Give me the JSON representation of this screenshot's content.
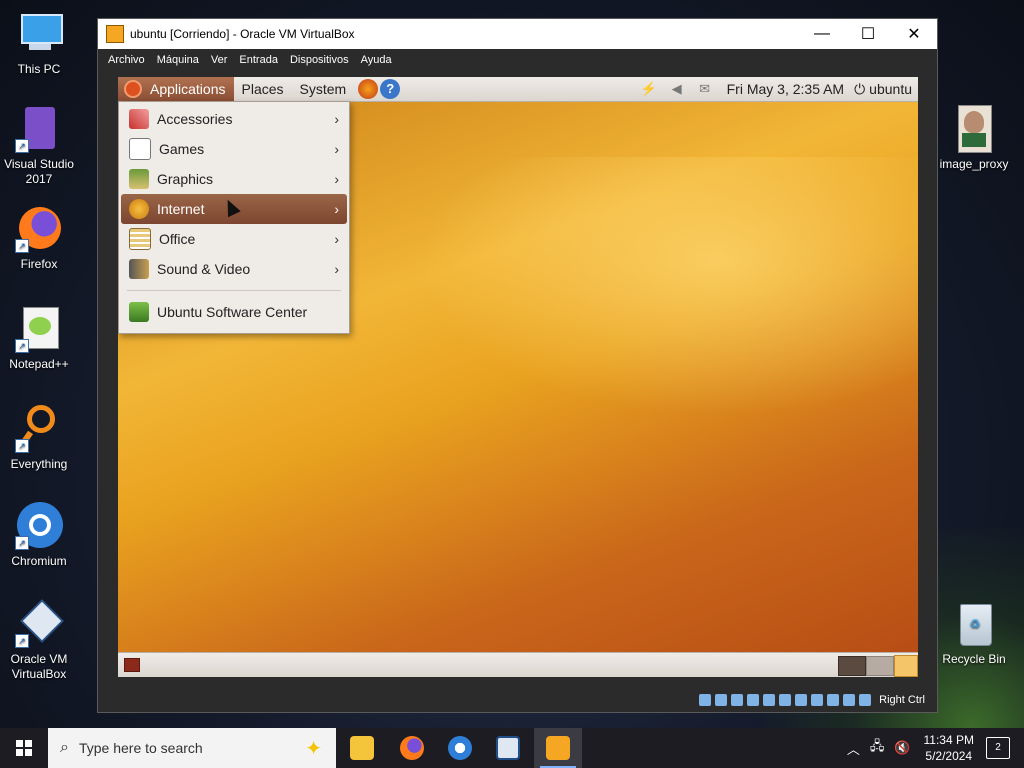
{
  "desktop": {
    "icons": [
      {
        "label": "This PC"
      },
      {
        "label": "Visual Studio 2017"
      },
      {
        "label": "Firefox"
      },
      {
        "label": "Notepad++"
      },
      {
        "label": "Everything"
      },
      {
        "label": "Chromium"
      },
      {
        "label": "Oracle VM VirtualBox"
      },
      {
        "label": "image_proxy"
      },
      {
        "label": "Recycle Bin"
      }
    ]
  },
  "vbox": {
    "title": "ubuntu [Corriendo] - Oracle VM VirtualBox",
    "menu": [
      "Archivo",
      "Máquina",
      "Ver",
      "Entrada",
      "Dispositivos",
      "Ayuda"
    ],
    "host_key": "Right Ctrl"
  },
  "guest": {
    "panel": {
      "applications": "Applications",
      "places": "Places",
      "system": "System",
      "clock": "Fri May  3,  2:35 AM",
      "user": "ubuntu"
    },
    "menu": {
      "items": [
        {
          "label": "Accessories",
          "icon": "accessories-icon"
        },
        {
          "label": "Games",
          "icon": "games-icon"
        },
        {
          "label": "Graphics",
          "icon": "graphics-icon"
        },
        {
          "label": "Internet",
          "icon": "internet-icon",
          "active": true
        },
        {
          "label": "Office",
          "icon": "office-icon"
        },
        {
          "label": "Sound & Video",
          "icon": "sound-video-icon"
        }
      ],
      "software_center": "Ubuntu Software Center"
    }
  },
  "taskbar": {
    "search_placeholder": "Type here to search",
    "time": "11:34 PM",
    "date": "5/2/2024",
    "notifications": "2"
  }
}
